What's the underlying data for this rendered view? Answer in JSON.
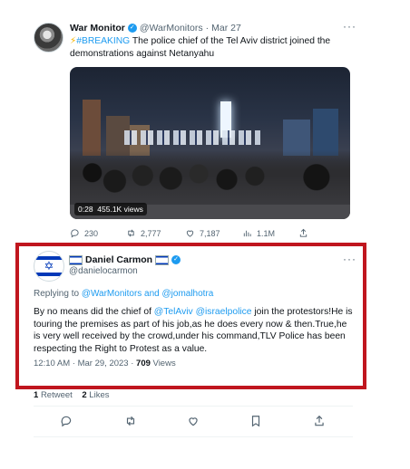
{
  "tweet1": {
    "author_name": "War Monitor",
    "handle": "@WarMonitors",
    "separator": "·",
    "date": "Mar 27",
    "lightning": "⚡",
    "hashtag": "#BREAKING",
    "text": " The police chief of the Tel Aviv district joined the demonstrations against Netanyahu",
    "video": {
      "duration": "0:28",
      "views": "455.1K views"
    },
    "counts": {
      "replies": "230",
      "retweets": "2,777",
      "likes": "7,187",
      "views": "1.1M"
    }
  },
  "tweet2": {
    "author_name": "Daniel Carmon",
    "handle": "@danielocarmon",
    "replying_prefix": "Replying to ",
    "replying_to": "@WarMonitors and @jomalhotra",
    "text_a": "By no means did the chief of ",
    "mention_1": "@TelAviv",
    "text_b": " ",
    "mention_2": "@israelpolice",
    "text_c": " join the protestors!He is touring the premises as part of his job,as he does every now & then.True,he is very well received by the crowd,under his command,TLV Police has been respecting the Right to Protest as a value.",
    "time": "12:10 AM",
    "separator": "·",
    "date": "Mar 29, 2023",
    "views_count": "709",
    "views_label": "Views",
    "retweets_count": "1",
    "retweets_label": "Retweet",
    "likes_count": "2",
    "likes_label": "Likes"
  },
  "icons": {
    "more": "···",
    "verified": "✓",
    "star_of_david": "✡"
  },
  "colors": {
    "accent": "#1d9bf0",
    "highlight_border": "#c0161e",
    "muted": "#536471",
    "israel_blue": "#0038b8"
  }
}
